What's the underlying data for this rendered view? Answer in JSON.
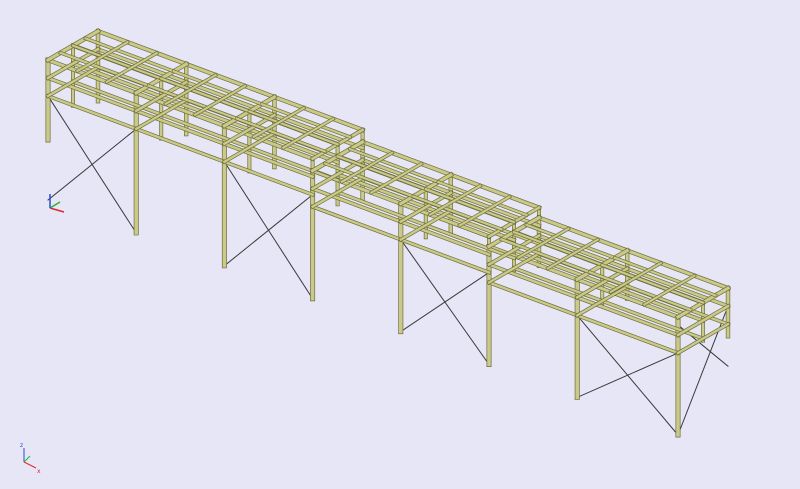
{
  "viewport": {
    "background": "#e6e6f7",
    "member_color": "#c9c98a",
    "member_dark": "#6f6f3c",
    "column_dark": "#4a4a2e",
    "bracing_color": "#3a3a3a"
  },
  "axis_triad": {
    "x_color": "#e0282c",
    "y_color": "#28b428",
    "z_color": "#2850d0",
    "x_label": "x",
    "y_label": "y",
    "z_label": "z"
  }
}
